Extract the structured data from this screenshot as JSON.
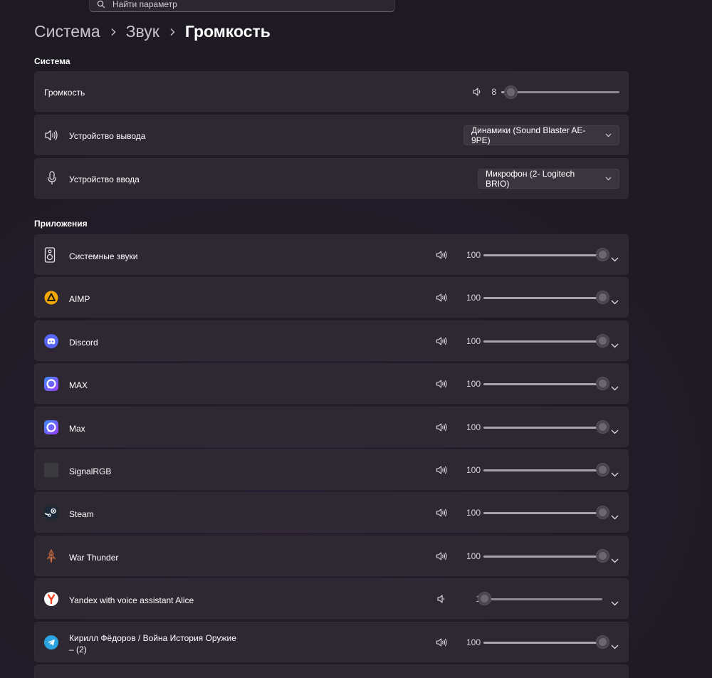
{
  "search": {
    "placeholder": "Найти параметр"
  },
  "breadcrumb": {
    "items": [
      "Система",
      "Звук"
    ],
    "current": "Громкость"
  },
  "system_section": {
    "title": "Система",
    "volume": {
      "label": "Громкость",
      "value": "8",
      "level": 8
    },
    "output": {
      "label": "Устройство вывода",
      "selected": "Динамики (Sound Blaster AE-9PE)"
    },
    "input": {
      "label": "Устройство ввода",
      "selected": "Микрофон (2- Logitech BRIO)"
    }
  },
  "apps_section": {
    "title": "Приложения",
    "apps": [
      {
        "name": "Системные звуки",
        "value": "100",
        "level": 100,
        "icon": "speaker-box-icon"
      },
      {
        "name": "AIMP",
        "value": "100",
        "level": 100,
        "icon": "aimp-icon"
      },
      {
        "name": "Discord",
        "value": "100",
        "level": 100,
        "icon": "discord-icon"
      },
      {
        "name": "MAX",
        "value": "100",
        "level": 100,
        "icon": "max-icon"
      },
      {
        "name": "Max",
        "value": "100",
        "level": 100,
        "icon": "max-icon"
      },
      {
        "name": "SignalRGB",
        "value": "100",
        "level": 100,
        "icon": "signalrgb-icon"
      },
      {
        "name": "Steam",
        "value": "100",
        "level": 100,
        "icon": "steam-icon"
      },
      {
        "name": "War Thunder",
        "value": "100",
        "level": 100,
        "icon": "war-thunder-icon"
      },
      {
        "name": "Yandex with voice assistant Alice",
        "value": "1",
        "level": 1,
        "icon": "yandex-icon"
      },
      {
        "name": "Кирилл Фёдоров / Война История Оружие\n– (2)",
        "value": "100",
        "level": 100,
        "icon": "telegram-icon"
      }
    ]
  },
  "colors": {
    "card": "#2e2833",
    "background": "#1e1a22",
    "slider_track": "#8d8892",
    "discord": "#5865f2",
    "aimp": "#f5a800",
    "yandex": "#fc3f1d",
    "telegram": "#2aa3e0"
  }
}
